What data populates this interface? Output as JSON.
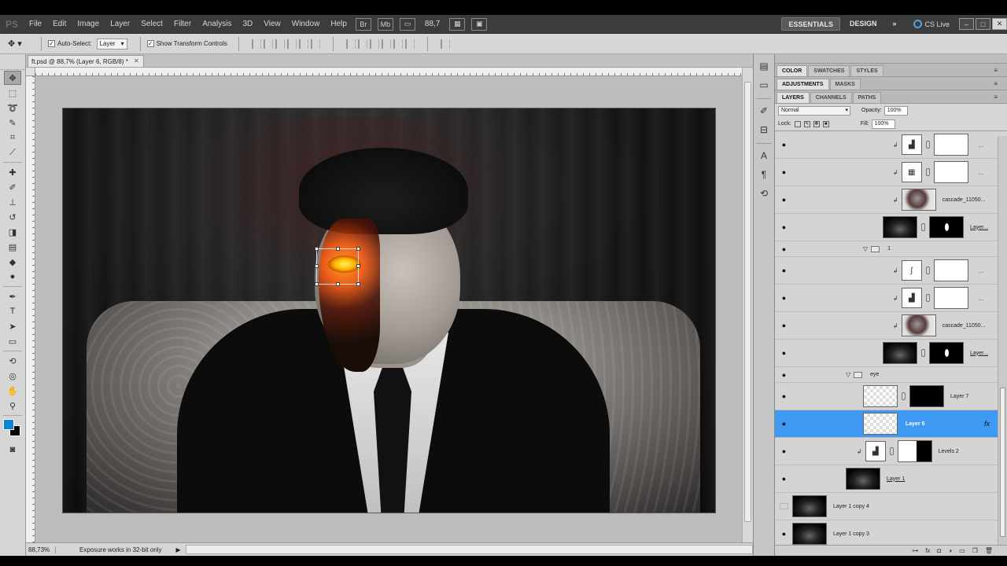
{
  "app": {
    "logo": "PS",
    "menu": [
      "File",
      "Edit",
      "Image",
      "Layer",
      "Select",
      "Filter",
      "Analysis",
      "3D",
      "View",
      "Window",
      "Help"
    ],
    "zoom_display": "88,7",
    "workspaces": [
      "ESSENTIALS",
      "DESIGN"
    ],
    "workspace_more": "»",
    "cs_live": "CS Live",
    "window_controls": [
      "–",
      "□",
      "✕"
    ]
  },
  "options_bar": {
    "auto_select_label": "Auto-Select:",
    "auto_select_value": "Layer",
    "show_transform_label": "Show Transform Controls"
  },
  "document": {
    "tab_title": "ft.psd @ 88,7% (Layer 6, RGB/8) *"
  },
  "status": {
    "zoom": "88,73%",
    "message": "Exposure works in 32-bit only"
  },
  "panels": {
    "tabs_top": [
      "COLOR",
      "SWATCHES",
      "STYLES"
    ],
    "tabs_mid": [
      "ADJUSTMENTS",
      "MASKS"
    ],
    "tabs_layers": [
      "LAYERS",
      "CHANNELS",
      "PATHS"
    ],
    "blend_mode": "Normal",
    "opacity_label": "Opacity:",
    "opacity_value": "100%",
    "lock_label": "Lock:",
    "fill_label": "Fill:",
    "fill_value": "100%"
  },
  "layers": [
    {
      "type": "adj",
      "name": "",
      "visible": true
    },
    {
      "type": "adj2",
      "name": "",
      "visible": true
    },
    {
      "type": "burn",
      "name": "cascade_11050...",
      "visible": true
    },
    {
      "type": "masked",
      "name": "Layer...",
      "visible": true
    },
    {
      "type": "group",
      "name": "1",
      "visible": true
    },
    {
      "type": "curves",
      "name": "",
      "visible": true
    },
    {
      "type": "adj",
      "name": "",
      "visible": true
    },
    {
      "type": "burn",
      "name": "cascade_11050...",
      "visible": true
    },
    {
      "type": "masked",
      "name": "Layer...",
      "visible": true
    },
    {
      "type": "group",
      "name": "eye",
      "visible": true
    },
    {
      "type": "layer7",
      "name": "Layer 7",
      "visible": true
    },
    {
      "type": "selected",
      "name": "Layer 6",
      "visible": true
    },
    {
      "type": "levels",
      "name": "Levels 2",
      "visible": true
    },
    {
      "type": "photo",
      "name": "Layer 1",
      "visible": true
    },
    {
      "type": "photo-bottom",
      "name": "Layer 1 copy 4",
      "visible": false
    },
    {
      "type": "photo-bottom",
      "name": "Layer 1 copy 3",
      "visible": true
    }
  ],
  "colors": {
    "selection": "#3f99f2",
    "foreground": "#0a84d8",
    "background": "#000000"
  }
}
